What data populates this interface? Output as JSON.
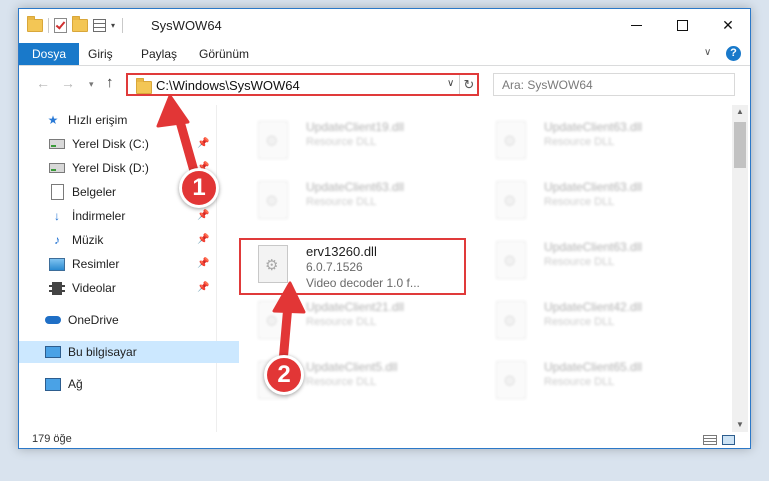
{
  "window": {
    "title": "SysWOW64"
  },
  "ribbon": {
    "tabs": [
      {
        "label": "Dosya"
      },
      {
        "label": "Giriş"
      },
      {
        "label": "Paylaş"
      },
      {
        "label": "Görünüm"
      }
    ],
    "help": "?",
    "chevron": "∨"
  },
  "controls": {
    "close": "✕"
  },
  "navbar": {
    "back": "←",
    "forward": "→",
    "recent": "▾",
    "up": "↑",
    "address": "C:\\Windows\\SysWOW64",
    "address_dropdown": "∨",
    "refresh": "↻",
    "search_placeholder": "Ara: SysWOW64"
  },
  "sidebar": {
    "quick_access": "Hızlı erişim",
    "items": [
      {
        "label": "Yerel Disk (C:)",
        "pinned": true
      },
      {
        "label": "Yerel Disk (D:)",
        "pinned": true
      },
      {
        "label": "Belgeler",
        "pinned": true
      },
      {
        "label": "İndirmeler",
        "pinned": true
      },
      {
        "label": "Müzik",
        "pinned": true
      },
      {
        "label": "Resimler",
        "pinned": true
      },
      {
        "label": "Videolar",
        "pinned": true
      }
    ],
    "pin_glyph": "📌",
    "onedrive": "OneDrive",
    "this_pc": "Bu bilgisayar",
    "network": "Ağ"
  },
  "files": {
    "left": [
      {
        "name": "UpdateClient19.dll",
        "desc": "Resource DLL"
      },
      {
        "name": "UpdateClient63.dll",
        "desc": "Resource DLL"
      },
      {
        "name": "UpdateClient21.dll",
        "desc": "Resource DLL"
      },
      {
        "name": "UpdateClient5.dll",
        "desc": "Resource DLL"
      }
    ],
    "right": [
      {
        "name": "UpdateClient63.dll",
        "desc": "Resource DLL"
      },
      {
        "name": "UpdateClient63.dll",
        "desc": "Resource DLL"
      },
      {
        "name": "UpdateClient63.dll",
        "desc": "Resource DLL"
      },
      {
        "name": "UpdateClient42.dll",
        "desc": "Resource DLL"
      },
      {
        "name": "UpdateClient65.dll",
        "desc": "Resource DLL"
      }
    ],
    "selected": {
      "name": "erv13260.dll",
      "version": "6.0.7.1526",
      "description": "Video decoder 1.0 f..."
    }
  },
  "status": {
    "count": "179 öğe"
  },
  "annotations": {
    "badge1": "1",
    "badge2": "2",
    "color": "#e23636"
  }
}
